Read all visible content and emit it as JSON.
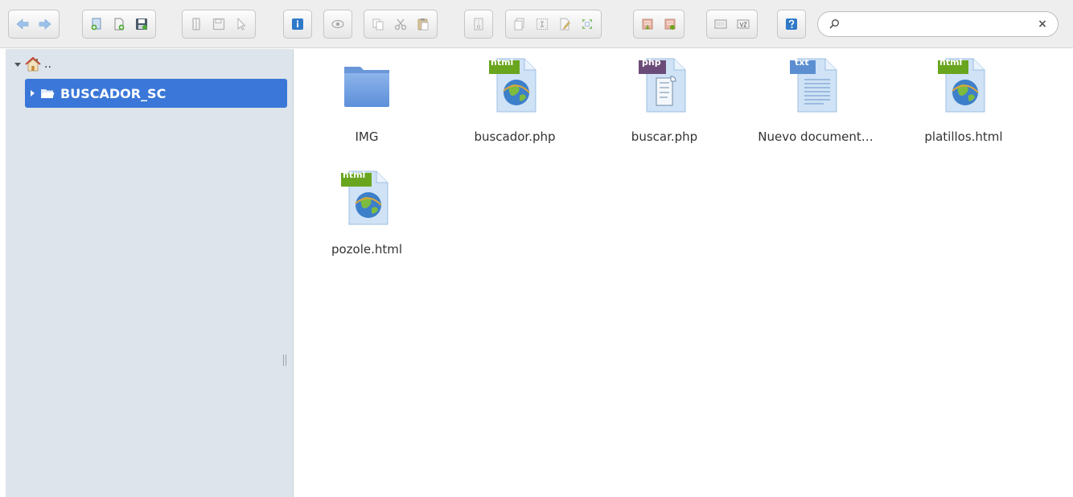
{
  "toolbar": {
    "groups": [
      [
        "back-icon",
        "forward-icon"
      ],
      [
        "new-folder-icon",
        "new-file-icon",
        "save-icon"
      ],
      [
        "open-icon",
        "save-disabled-icon",
        "select-icon"
      ],
      [
        "info-icon"
      ],
      [
        "preview-icon"
      ],
      [
        "copy-icon",
        "cut-icon",
        "paste-icon"
      ],
      [
        "archive-icon"
      ],
      [
        "duplicate-icon",
        "rename-icon",
        "edit-icon",
        "resize-icon"
      ],
      [
        "extract-icon",
        "compress-icon"
      ],
      [
        "view-icon",
        "sort-icon"
      ],
      [
        "help-icon"
      ]
    ]
  },
  "search": {
    "value": "",
    "placeholder": "",
    "clear_label": "×"
  },
  "sidebar": {
    "root_label": "..",
    "selected_folder": "BUSCADOR_SC"
  },
  "files": [
    {
      "name": "IMG",
      "type": "folder"
    },
    {
      "name": "buscador.php",
      "type": "html",
      "badge": "html"
    },
    {
      "name": "buscar.php",
      "type": "php",
      "badge": "php"
    },
    {
      "name": "Nuevo document…",
      "type": "txt",
      "badge": "txt"
    },
    {
      "name": "platillos.html",
      "type": "html",
      "badge": "html"
    },
    {
      "name": "pozole.html",
      "type": "html",
      "badge": "html"
    }
  ],
  "colors": {
    "selection": "#3a77d8",
    "sidebar_bg": "#dde4eb",
    "html_badge": "#6aa51f",
    "php_badge": "#6b4c78",
    "txt_badge": "#5b8fd1"
  }
}
